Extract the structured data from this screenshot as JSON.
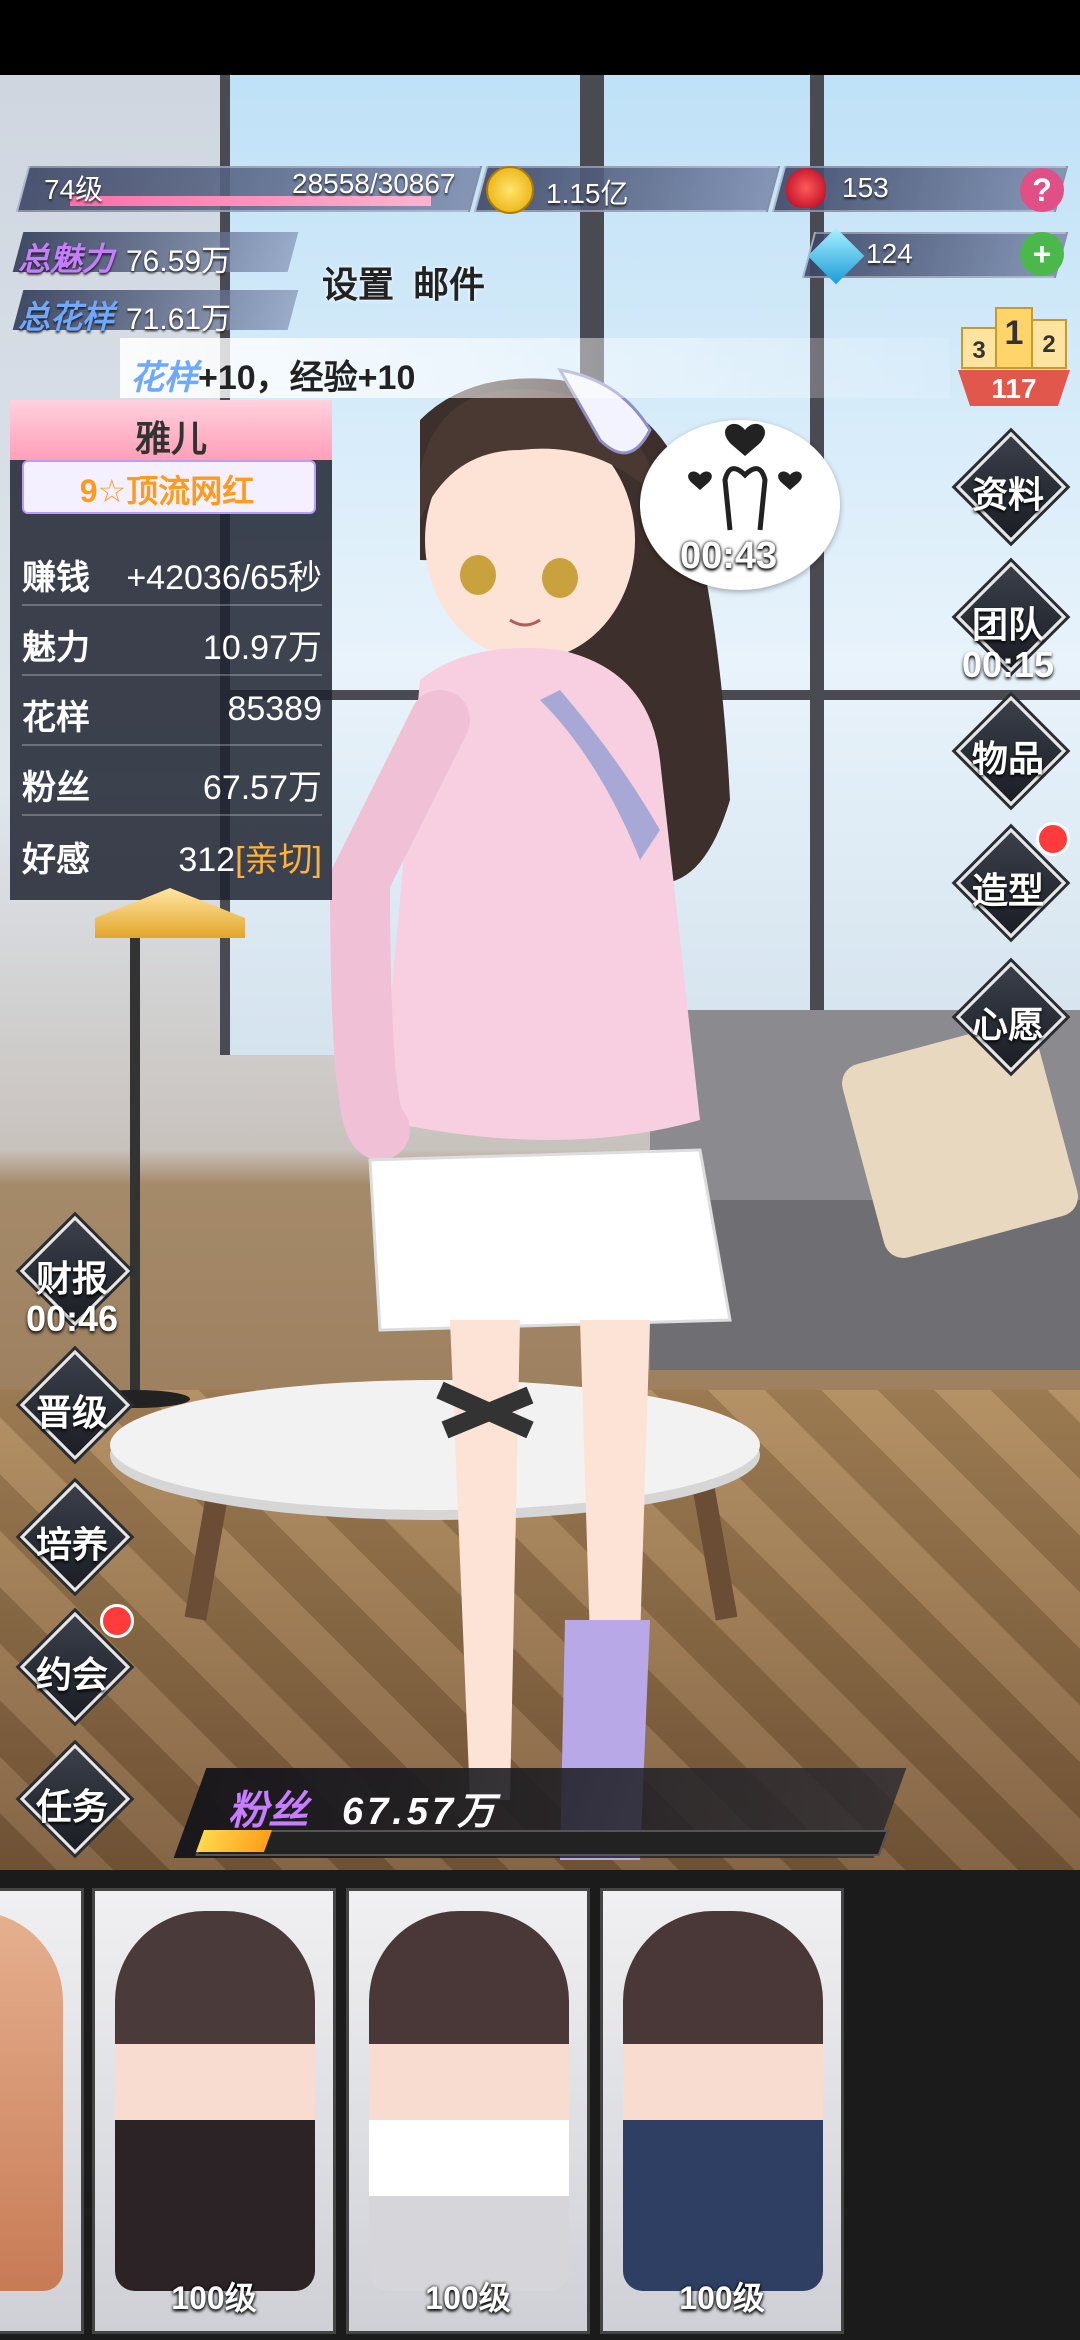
{
  "hud": {
    "level": "74级",
    "exp": "28558/30867",
    "exp_ratio": 0.925,
    "gold": "1.15亿",
    "roses": "153",
    "diamonds": "124",
    "help": "?",
    "add": "+"
  },
  "charm": {
    "label": "总魅力",
    "value": "76.59万"
  },
  "pattern": {
    "label": "总花样",
    "value": "71.61万"
  },
  "menu": {
    "settings": "设置",
    "mail": "邮件"
  },
  "message": {
    "highlight": "花样",
    "text": "+10，经验+10"
  },
  "rank": {
    "podium": [
      "3",
      "1",
      "2"
    ],
    "value": "117"
  },
  "profile": {
    "name": "雅儿",
    "title": "9☆顶流网红",
    "stats": [
      {
        "key": "赚钱",
        "value": "+42036/65秒"
      },
      {
        "key": "魅力",
        "value": "10.97万"
      },
      {
        "key": "花样",
        "value": "85389"
      },
      {
        "key": "粉丝",
        "value": "67.57万"
      },
      {
        "key": "好感",
        "value": "312",
        "tag": "[亲切]"
      }
    ]
  },
  "bubble_timer": "00:43",
  "right_buttons": [
    {
      "label": "资料"
    },
    {
      "label": "团队",
      "timer": "00:15"
    },
    {
      "label": "物品"
    },
    {
      "label": "造型",
      "badge": true
    },
    {
      "label": "心愿"
    }
  ],
  "left_buttons": [
    {
      "label": "财报",
      "timer": "00:46"
    },
    {
      "label": "晋级"
    },
    {
      "label": "培养"
    },
    {
      "label": "约会",
      "badge": true
    },
    {
      "label": "任务"
    }
  ],
  "fans": {
    "label": "粉丝",
    "value": "67.57万",
    "progress": 0.1
  },
  "cards": [
    {
      "level": ""
    },
    {
      "level": "100级"
    },
    {
      "level": "100级"
    },
    {
      "level": "100级"
    }
  ],
  "colors": {
    "accent_pink": "#ff9fb8",
    "accent_purple": "#c77dff",
    "gold": "#ffb23a"
  }
}
